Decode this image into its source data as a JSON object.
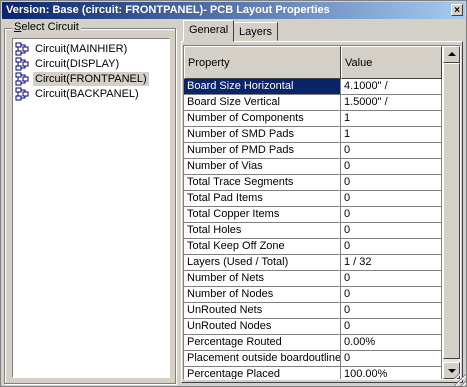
{
  "window": {
    "title": "Version: Base (circuit: FRONTPANEL)- PCB Layout Properties",
    "close_glyph": "×"
  },
  "left_panel": {
    "group_label_prefix": "S",
    "group_label_rest": "elect Circuit",
    "circuits": [
      {
        "label": "Circuit(MAINHIER)",
        "selected": false
      },
      {
        "label": "Circuit(DISPLAY)",
        "selected": false
      },
      {
        "label": "Circuit(FRONTPANEL)",
        "selected": true
      },
      {
        "label": "Circuit(BACKPANEL)",
        "selected": false
      }
    ]
  },
  "tabs": [
    {
      "label": "General",
      "active": true
    },
    {
      "label": "Layers",
      "active": false
    }
  ],
  "grid": {
    "headers": [
      "Property",
      "Value"
    ],
    "rows": [
      {
        "property": "Board Size Horizontal",
        "value": "4.1000\" /"
      },
      {
        "property": "Board Size Vertical",
        "value": "1.5000\" /"
      },
      {
        "property": "Number of Components",
        "value": "1"
      },
      {
        "property": "Number of SMD Pads",
        "value": "1"
      },
      {
        "property": "Number of PMD Pads",
        "value": "0"
      },
      {
        "property": "Number of Vias",
        "value": "0"
      },
      {
        "property": "Total Trace Segments",
        "value": "0"
      },
      {
        "property": "Total Pad Items",
        "value": "0"
      },
      {
        "property": "Total Copper Items",
        "value": "0"
      },
      {
        "property": "Total Holes",
        "value": "0"
      },
      {
        "property": "Total Keep Off Zone",
        "value": "0"
      },
      {
        "property": "Layers (Used / Total)",
        "value": "1 / 32"
      },
      {
        "property": "Number of Nets",
        "value": "0"
      },
      {
        "property": "Number of Nodes",
        "value": "0"
      },
      {
        "property": "UnRouted Nets",
        "value": "0"
      },
      {
        "property": "UnRouted Nodes",
        "value": "0"
      },
      {
        "property": "Percentage Routed",
        "value": "0.00%"
      },
      {
        "property": "Placement outside boardoutline",
        "value": "0"
      },
      {
        "property": "Percentage Placed",
        "value": "100.00%"
      }
    ],
    "selected_row": 0
  },
  "colors": {
    "title_start": "#0a246a",
    "title_end": "#a6caf0",
    "selection": "#0a246a",
    "face": "#d4d0c8"
  }
}
